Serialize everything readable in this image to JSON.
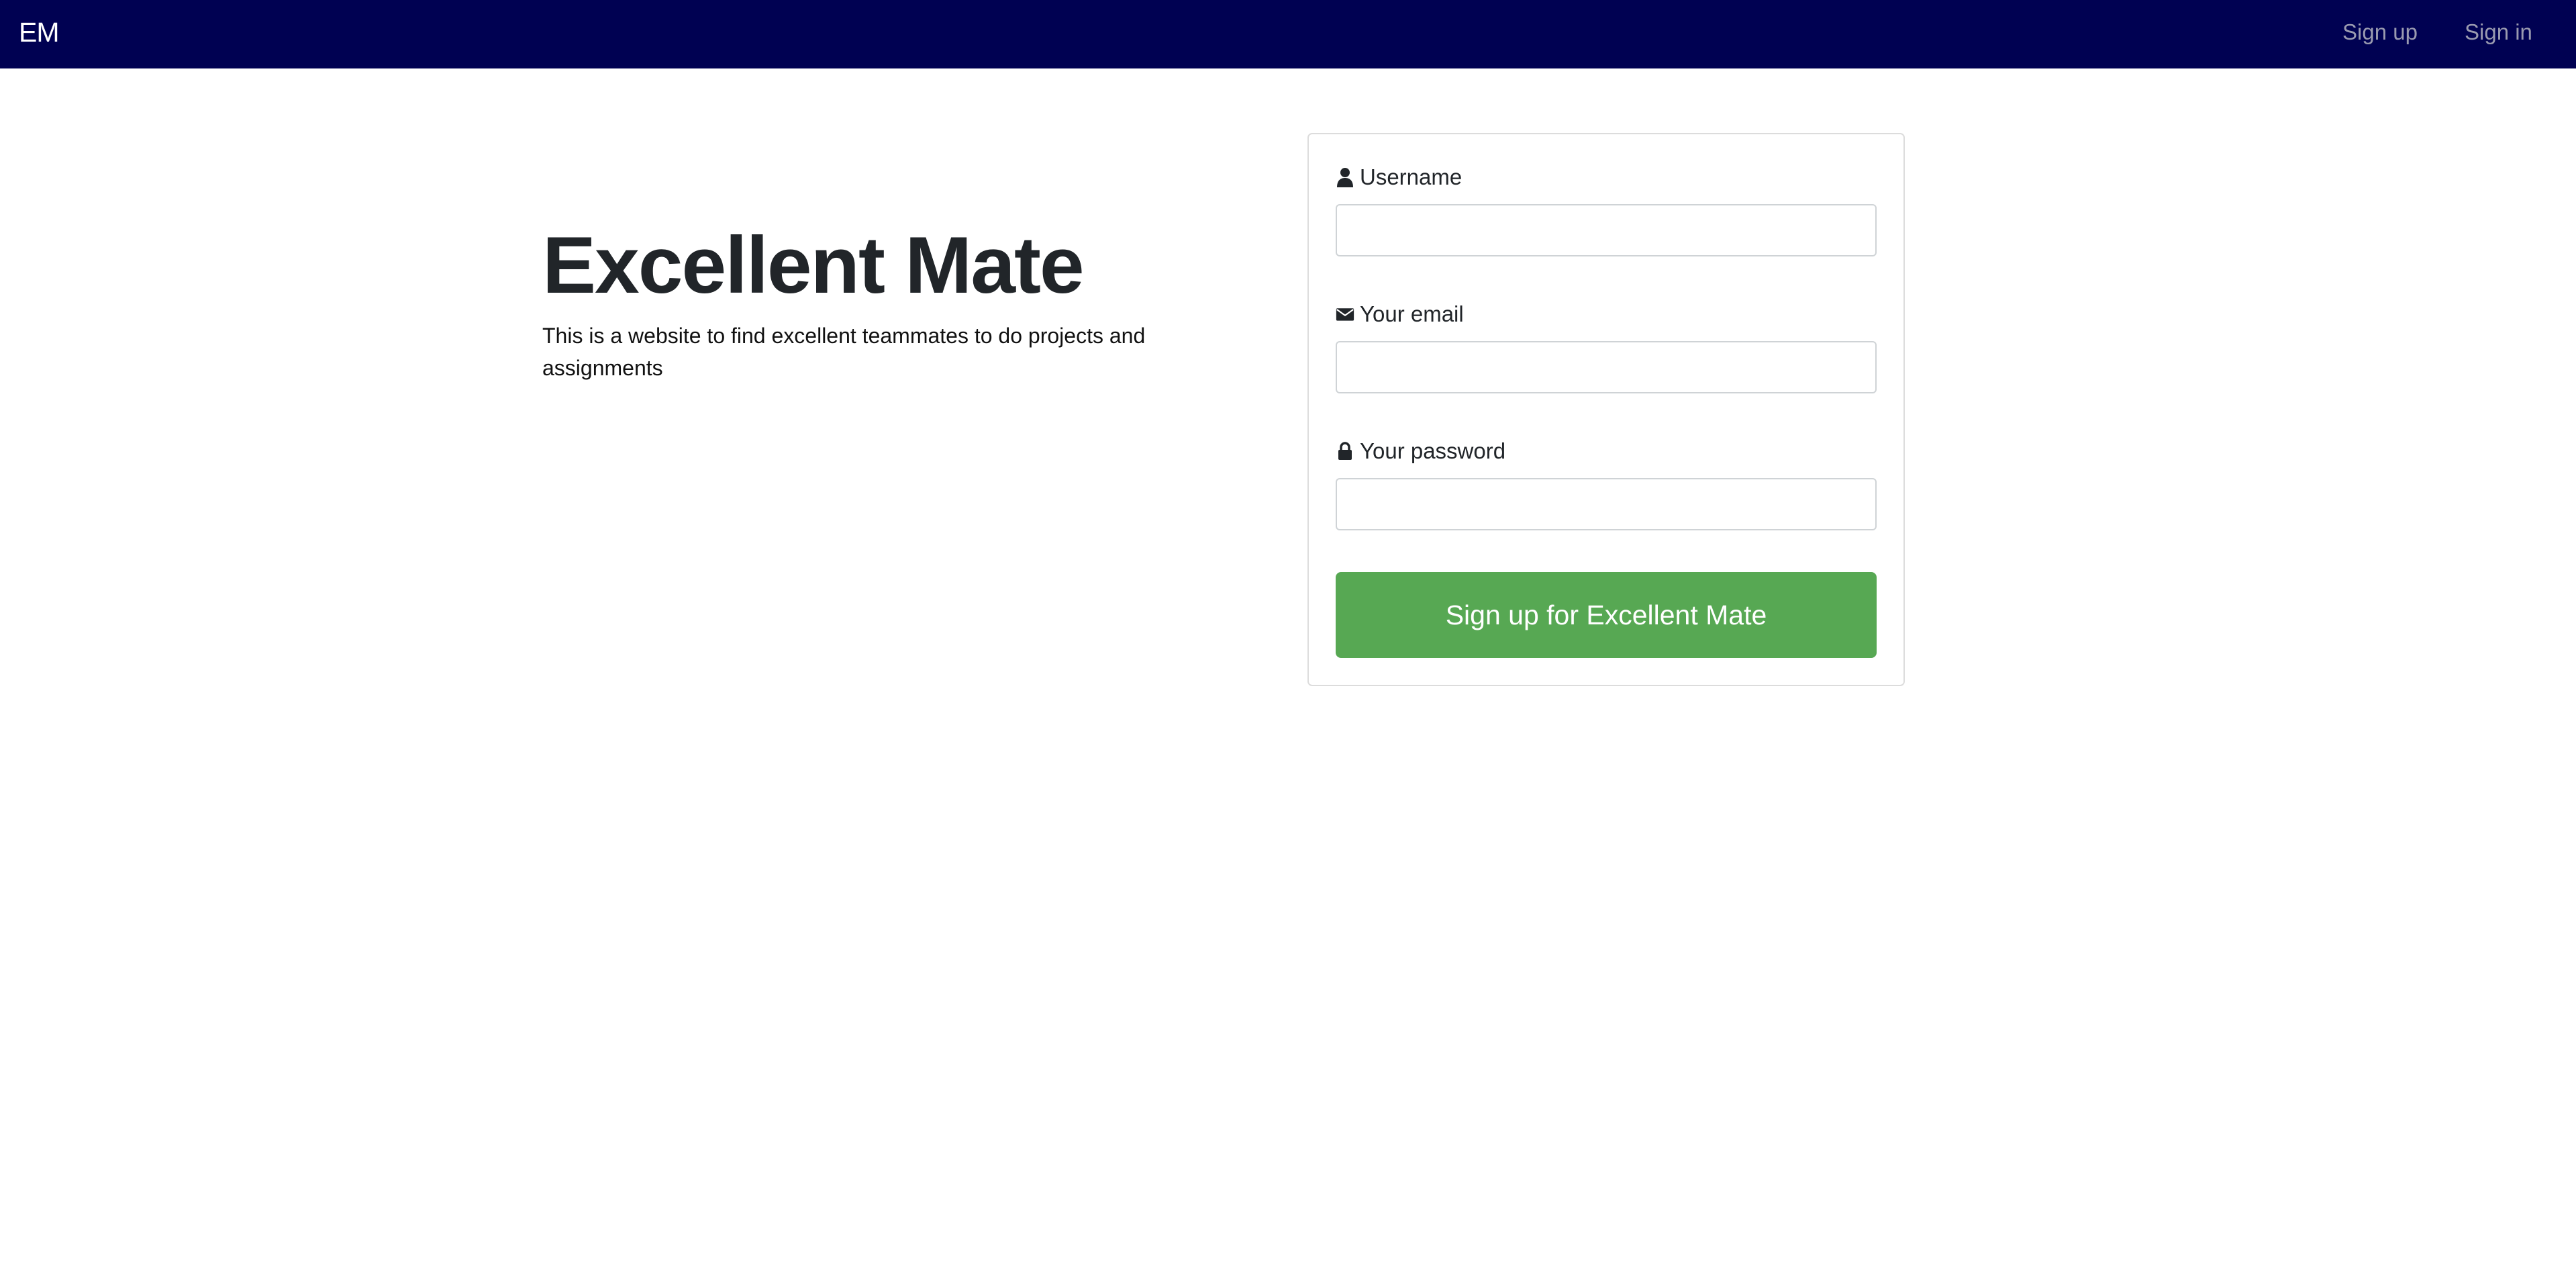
{
  "navbar": {
    "brand": "EM",
    "links": [
      {
        "label": "Sign up"
      },
      {
        "label": "Sign in"
      }
    ],
    "background_color": "#000152"
  },
  "hero": {
    "title": "Excellent Mate",
    "description": "This is a website to find excellent teammates to do projects and assignments"
  },
  "signup_form": {
    "fields": [
      {
        "icon": "user-icon",
        "label": "Username",
        "value": "",
        "placeholder": ""
      },
      {
        "icon": "envelope-icon",
        "label": "Your email",
        "value": "",
        "placeholder": ""
      },
      {
        "icon": "lock-icon",
        "label": "Your password",
        "value": "",
        "placeholder": ""
      }
    ],
    "submit_label": "Sign up for Excellent Mate",
    "submit_color": "#57a853"
  }
}
